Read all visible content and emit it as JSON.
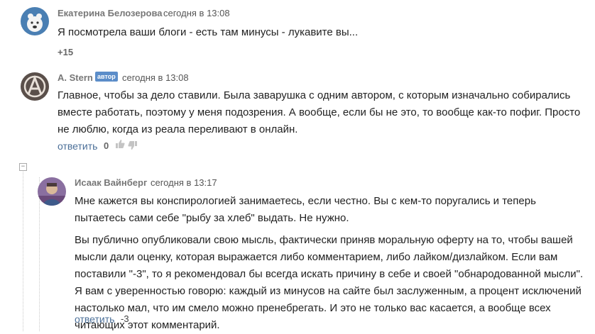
{
  "comments": [
    {
      "author": "Екатерина Белозерова",
      "time": "сегодня в 13:08",
      "text": "Я посмотрела ваши блоги - есть там минусы - лукавите вы...",
      "rating": "+15"
    },
    {
      "author": "A. Stern",
      "badge": "автор",
      "time": "сегодня в 13:08",
      "text": "Главное, чтобы за дело ставили. Была заварушка с одним автором, с которым изначально собирались вместе работать, поэтому у меня подозрения. А вообще, если бы не это, то вообще как-то пофиг. Просто не люблю, когда из реала переливают в онлайн.",
      "reply_label": "ответить",
      "rating": "0"
    },
    {
      "author": "Исаак Вайнберг",
      "time": "сегодня в 13:17",
      "paragraphs": [
        "Мне кажется вы конспирологией занимаетесь, если честно. Вы с кем-то поругались и теперь пытаетесь сами себе \"рыбу за хлеб\" выдать. Не нужно.",
        "Вы публично опубликовали свою мысль, фактически приняв моральную оферту на то, чтобы вашей мысли дали оценку, которая выражается либо комментарием, либо лайком/дизлайком. Если вам поставили \"-3\", то я рекомендовал бы всегда искать причину в себе и своей \"обнародованной мысли\". Я вам с уверенностью говорю: каждый из минусов на сайте был заслуженным, а процент исключений настолько мал, что им смело можно пренебрегать. И это не только вас касается, а вообще всех читающих этот комментарий."
      ],
      "reply_label": "ответить",
      "rating": "-3"
    }
  ],
  "thread": {
    "collapse_symbol": "−"
  },
  "icons": {
    "like": "thumbs-up-icon",
    "dislike": "thumbs-down-icon"
  }
}
